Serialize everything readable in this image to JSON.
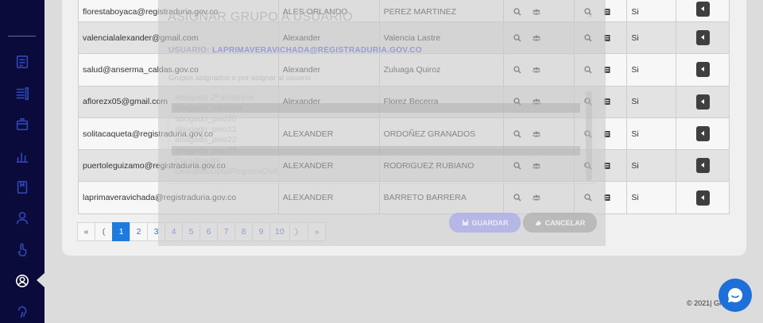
{
  "sidebar": {
    "icons": [
      "list-icon",
      "list-detail-icon",
      "box-icon",
      "bar-chart-icon",
      "book-icon",
      "user-icon",
      "hand-pointer-icon",
      "user-circle-icon",
      "fingerprint-icon"
    ]
  },
  "table": {
    "rows": [
      {
        "email": "florestaboyaca@registraduria.gov.co",
        "name": "ALES ORLANDO",
        "last": "PEREZ MARTINEZ",
        "status": "Si"
      },
      {
        "email": "valencialalexander@gmail.com",
        "name": "Alexander",
        "last": "Valencia Lastre",
        "status": "Si"
      },
      {
        "email": "salud@anserma_caldas.gov.co",
        "name": "Alexander",
        "last": "Zuluaga Quiroz",
        "status": "Si"
      },
      {
        "email": "aflorezx05@gmail.com",
        "name": "Alexander",
        "last": "Florez Becerra",
        "status": "Si"
      },
      {
        "email": "solitacaqueta@registraduria.gov.co",
        "name": "ALEXANDER",
        "last": "ORDOÑEZ GRANADOS",
        "status": "Si"
      },
      {
        "email": "puertoleguizamo@registraduria.gov.co",
        "name": "ALEXANDER",
        "last": "RODRIGUEZ RUBIANO",
        "status": "Si"
      },
      {
        "email": "laprimaveravichada@registraduria.gov.co",
        "name": "ALEXANDER",
        "last": "BARRETO BARRERA",
        "status": "Si"
      }
    ]
  },
  "pagination": {
    "first": "«",
    "prev": "(",
    "pages": [
      "1",
      "2",
      "3",
      "4",
      "5",
      "6",
      "7",
      "8",
      "9",
      "10"
    ],
    "active": "1",
    "next": "〉",
    "last": "»"
  },
  "footer": {
    "text": "© 2021| Gr"
  },
  "modal": {
    "title": "ASIGNAR GRUPO A USUARIO",
    "close": "×",
    "user_label": "USUARIO:",
    "user_value": "LAPRIMAVERAVICHADA@REGISTRADURIA.GOV.CO",
    "hint": "Grupos asignados o por asignar al usuario",
    "groups": [
      {
        "label": "Abogado 2ª instancia",
        "selected": false
      },
      {
        "label": "abogado_nacional",
        "selected": true
      },
      {
        "label": "abogado_piso20",
        "selected": false
      },
      {
        "label": "abogado_piso21",
        "selected": false
      },
      {
        "label": "abogado_piso22",
        "selected": false
      },
      {
        "label": "abogado_piso23",
        "selected": true
      },
      {
        "label": "Coordinador",
        "selected": false
      },
      {
        "label": "DelegadoDptalRegistroCivil",
        "selected": false
      }
    ],
    "save_label": "GUARDAR",
    "cancel_label": "CANCELAR"
  }
}
